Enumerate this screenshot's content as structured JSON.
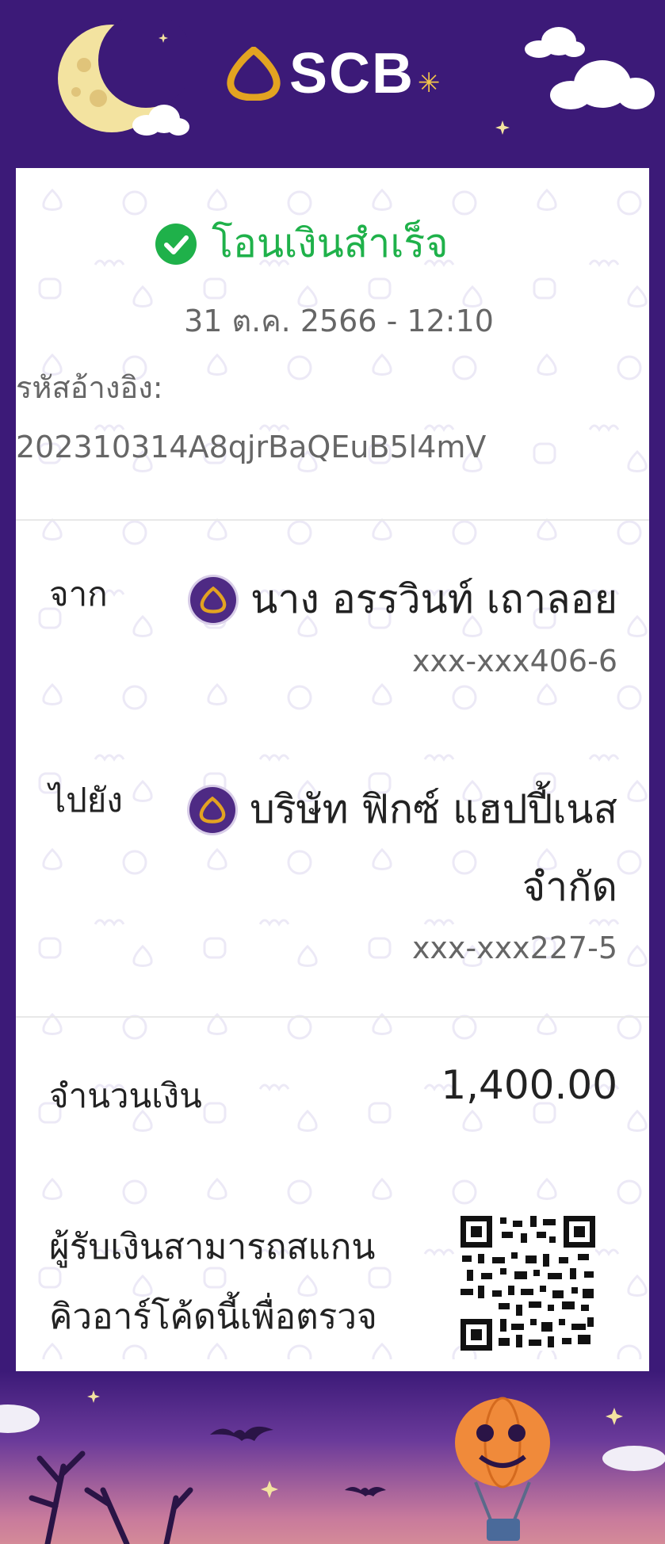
{
  "header": {
    "brand": "SCB"
  },
  "status": {
    "text": "โอนเงินสำเร็จ"
  },
  "datetime": "31 ต.ค. 2566 - 12:10",
  "reference": {
    "label": "รหัสอ้างอิง:",
    "value": "202310314A8qjrBaQEuB5l4mV"
  },
  "from": {
    "label": "จาก",
    "name": "นาง อรรวินท์ เถาลอย",
    "account": "xxx-xxx406-6"
  },
  "to": {
    "label": "ไปยัง",
    "name_line1": "บริษัท ฟิกซ์ แฮปปี้เนส",
    "name_line2": "จำกัด",
    "account": "xxx-xxx227-5"
  },
  "amount": {
    "label": "จำนวนเงิน",
    "value": "1,400.00"
  },
  "note": {
    "line1": "ผู้รับเงินสามารถสแกน",
    "line2": "คิวอาร์โค้ดนี้เพื่อตรวจ"
  },
  "colors": {
    "brand_purple": "#3c1a78",
    "success_green": "#1fb14a",
    "gold": "#f2c44a"
  },
  "icons": [
    "moon-icon",
    "cloud-icon",
    "check-circle-icon",
    "scb-bank-icon",
    "qr-code",
    "pumpkin-balloon",
    "bat-icon",
    "star-icon"
  ]
}
